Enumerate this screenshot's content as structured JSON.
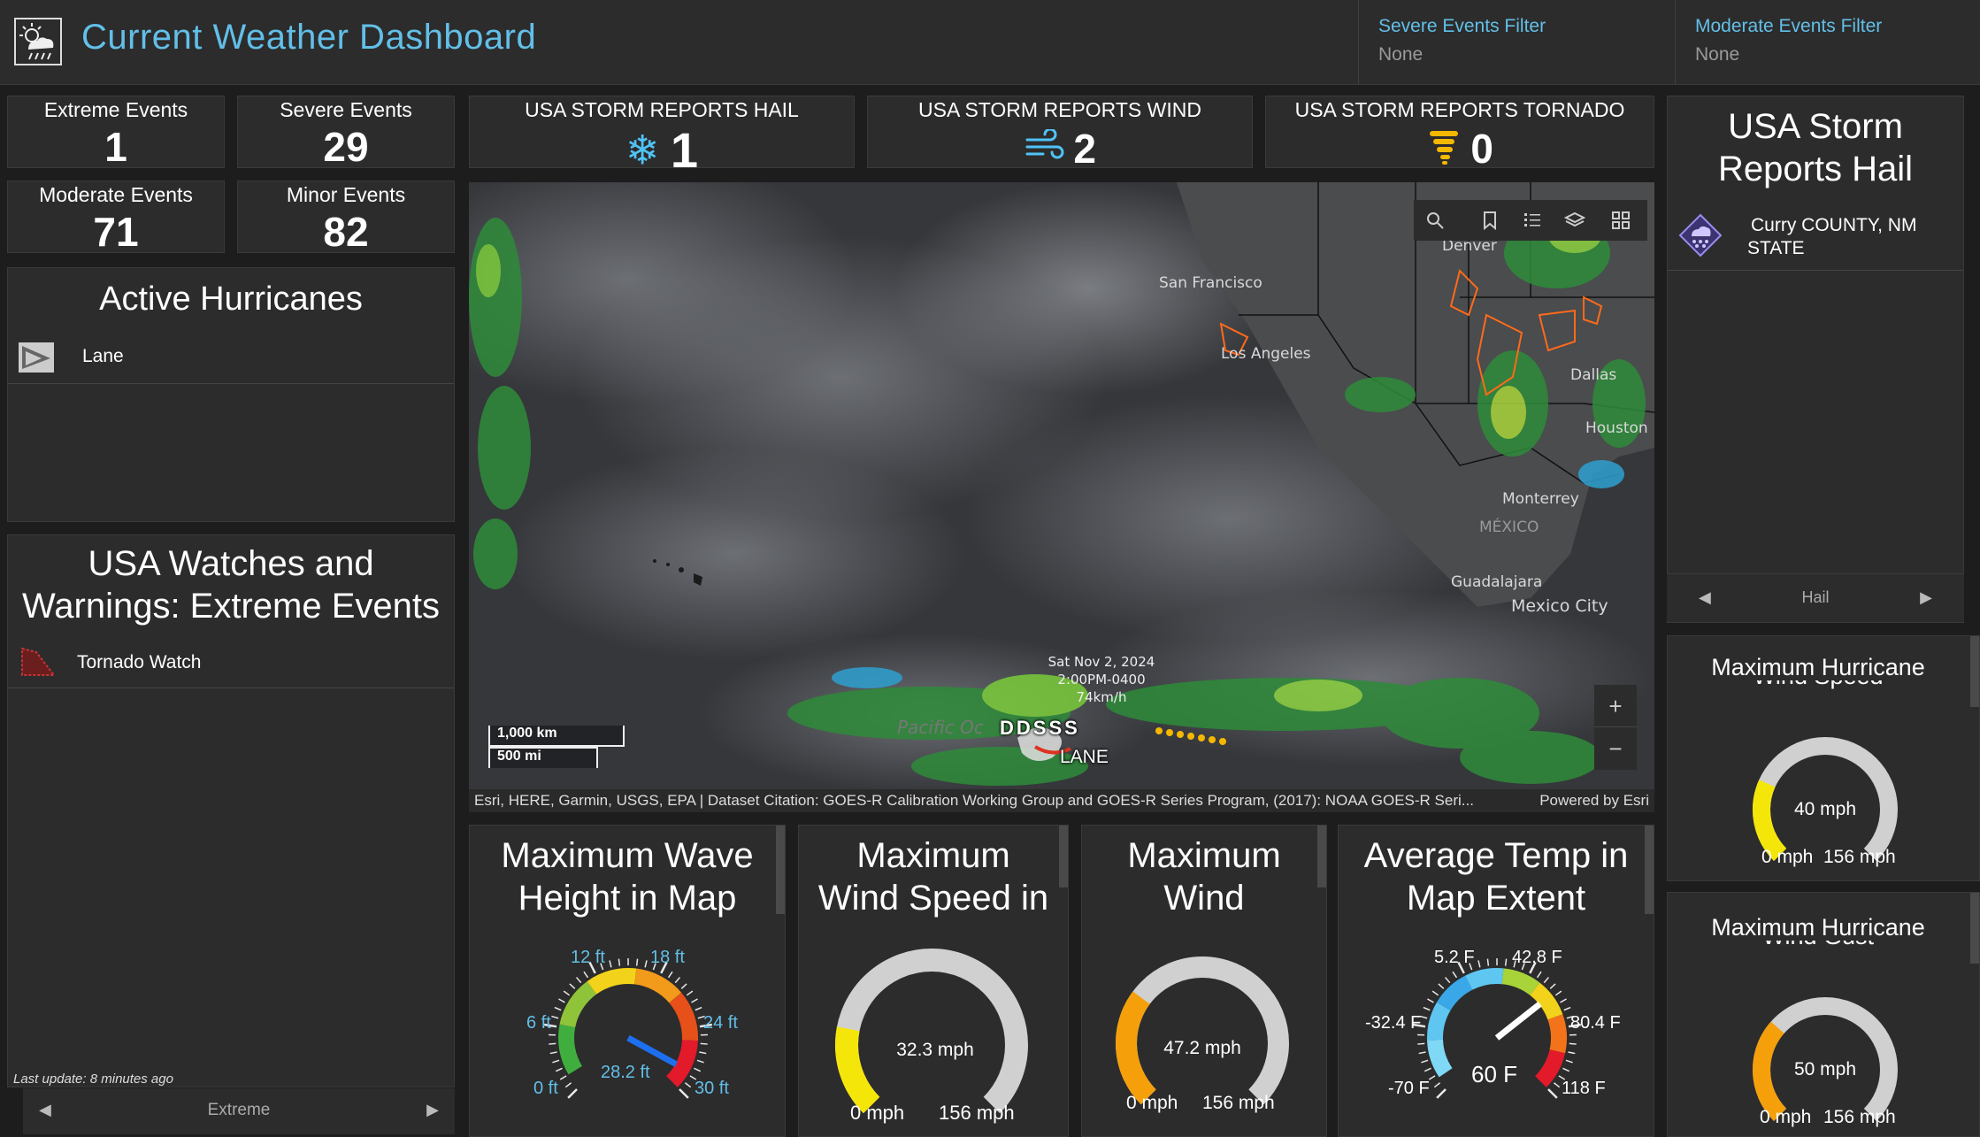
{
  "header": {
    "title": "Current Weather Dashboard",
    "filters": [
      {
        "label": "Severe Events Filter",
        "value": "None"
      },
      {
        "label": "Moderate Events Filter",
        "value": "None"
      }
    ]
  },
  "event_counts": [
    {
      "label": "Extreme Events",
      "value": "1"
    },
    {
      "label": "Severe Events",
      "value": "29"
    },
    {
      "label": "Moderate Events",
      "value": "71"
    },
    {
      "label": "Minor Events",
      "value": "82"
    }
  ],
  "storm_reports": [
    {
      "label": "USA STORM REPORTS HAIL",
      "value": "1",
      "icon": "snowflake-icon",
      "color": "#4fc3f7"
    },
    {
      "label": "USA STORM REPORTS WIND",
      "value": "2",
      "icon": "wind-icon",
      "color": "#4fc3f7"
    },
    {
      "label": "USA STORM REPORTS TORNADO",
      "value": "0",
      "icon": "tornado-icon",
      "color": "#f5b800"
    }
  ],
  "hurricanes": {
    "title": "Active Hurricanes",
    "items": [
      {
        "name": "Lane"
      }
    ]
  },
  "watches": {
    "title_line1": "USA Watches and",
    "title_line2": "Warnings: Extreme Events",
    "items": [
      {
        "name": "Tornado Watch"
      }
    ],
    "last_update": "Last update: 8 minutes ago",
    "pager_label": "Extreme"
  },
  "map": {
    "cities": [
      "San Francisco",
      "Los Angeles",
      "Denver",
      "Dallas",
      "Houston",
      "Monterrey",
      "MÉXICO",
      "Guadalajara",
      "Mexico City",
      "Pacific Oc"
    ],
    "storm_label_time_line1": "Sat Nov 2, 2024",
    "storm_label_time_line2": "2:00PM-0400",
    "storm_label_speed": "74km/h",
    "storm_codes": "DDSSS",
    "storm_name": "LANE",
    "scale_km": "1,000 km",
    "scale_mi": "500 mi",
    "attribution": "Esri, HERE, Garmin, USGS, EPA | Dataset Citation: GOES-R Calibration Working Group and GOES-R Series Program, (2017): NOAA GOES-R Seri...",
    "powered_by": "Powered by Esri",
    "zoom_in": "+",
    "zoom_out": "−"
  },
  "hail_panel": {
    "title_line1": "USA Storm",
    "title_line2": "Reports Hail",
    "item_line1": "Curry COUNTY, NM",
    "item_line2": "STATE",
    "pager_label": "Hail"
  },
  "gauges": {
    "wave": {
      "title_line1": "Maximum Wave",
      "title_line2": "Height in Map",
      "value": 28.2,
      "value_label": "28.2 ft",
      "min": 0,
      "max": 30,
      "ticks": [
        "0 ft",
        "6 ft",
        "12 ft",
        "18 ft",
        "24 ft",
        "30 ft"
      ]
    },
    "wind_speed": {
      "title_line1": "Maximum",
      "title_line2": "Wind Speed in",
      "value": 32.3,
      "value_label": "32.3 mph",
      "min_label": "0 mph",
      "max_label": "156 mph",
      "max": 156,
      "color": "#f5e60a"
    },
    "wind": {
      "title_line1": "Maximum",
      "title_line2": "Wind",
      "value": 47.2,
      "value_label": "47.2 mph",
      "min_label": "0 mph",
      "max_label": "156 mph",
      "max": 156,
      "color": "#f5a00a"
    },
    "temp": {
      "title_line1": "Average Temp in",
      "title_line2": "Map Extent",
      "value": 60,
      "value_label": "60 F",
      "min": -70,
      "max": 118,
      "ticks": [
        "-70 F",
        "-32.4 F",
        "5.2 F",
        "42.8 F",
        "80.4 F",
        "118 F"
      ]
    },
    "hurricane_wind_speed": {
      "title_line1": "Maximum Hurricane",
      "title_line2": "Wind Speed",
      "value": 40,
      "value_label": "40 mph",
      "min_label": "0 mph",
      "max_label": "156 mph",
      "max": 156,
      "color": "#f5e60a"
    },
    "hurricane_wind_gust": {
      "title_line1": "Maximum Hurricane",
      "title_line2": "Wind Gust",
      "value": 50,
      "value_label": "50 mph",
      "min_label": "0 mph",
      "max_label": "156 mph",
      "max": 156,
      "color": "#f5a00a"
    }
  }
}
